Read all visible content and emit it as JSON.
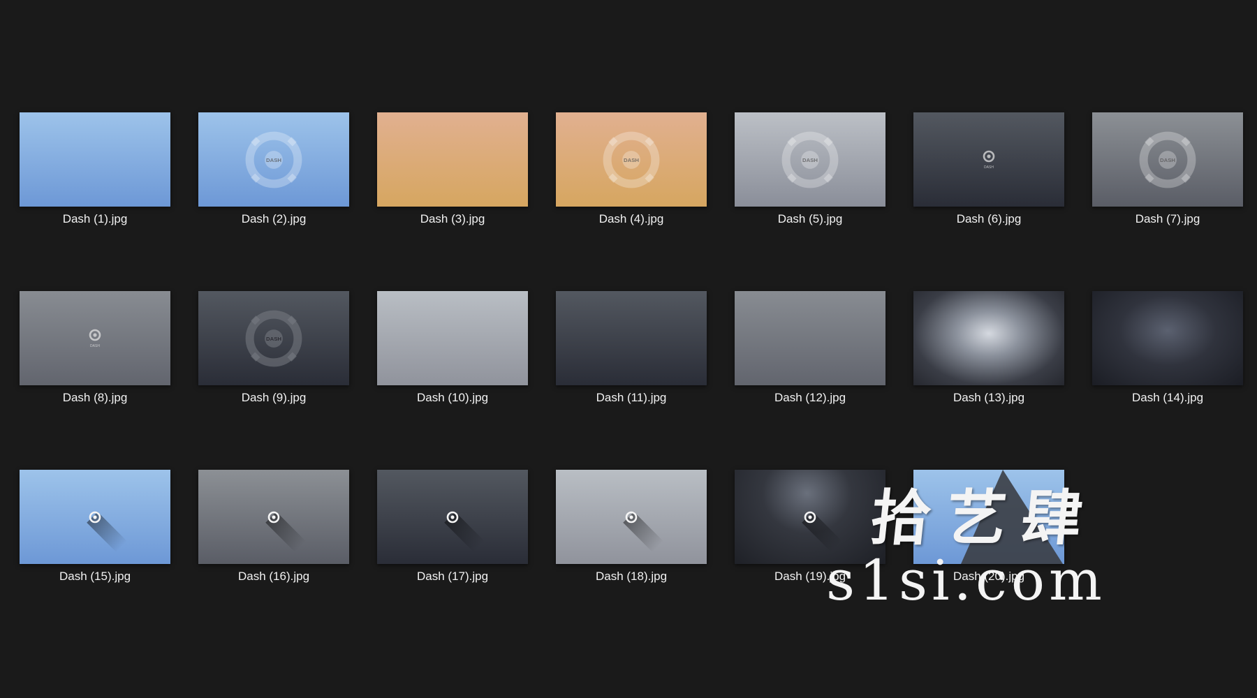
{
  "files": [
    {
      "name": "Dash (1).jpg",
      "bg": "bg-blue",
      "logo": "none"
    },
    {
      "name": "Dash (2).jpg",
      "bg": "bg-blue",
      "logo": "ring"
    },
    {
      "name": "Dash (3).jpg",
      "bg": "bg-orange",
      "logo": "none"
    },
    {
      "name": "Dash (4).jpg",
      "bg": "bg-orange",
      "logo": "ring"
    },
    {
      "name": "Dash (5).jpg",
      "bg": "bg-silver",
      "logo": "ring"
    },
    {
      "name": "Dash (6).jpg",
      "bg": "bg-dark",
      "logo": "small-text"
    },
    {
      "name": "Dash (7).jpg",
      "bg": "bg-gray",
      "logo": "ring"
    },
    {
      "name": "Dash (8).jpg",
      "bg": "bg-mid",
      "logo": "small-text"
    },
    {
      "name": "Dash (9).jpg",
      "bg": "bg-dark",
      "logo": "ring-dark"
    },
    {
      "name": "Dash (10).jpg",
      "bg": "bg-light",
      "logo": "none"
    },
    {
      "name": "Dash (11).jpg",
      "bg": "bg-dark",
      "logo": "none"
    },
    {
      "name": "Dash (12).jpg",
      "bg": "bg-mid",
      "logo": "none"
    },
    {
      "name": "Dash (13).jpg",
      "bg": "bg-glow-bright",
      "logo": "none"
    },
    {
      "name": "Dash (14).jpg",
      "bg": "bg-glow-dim",
      "logo": "none"
    },
    {
      "name": "Dash (15).jpg",
      "bg": "bg-blue",
      "logo": "small-shadow"
    },
    {
      "name": "Dash (16).jpg",
      "bg": "bg-gray",
      "logo": "small-shadow"
    },
    {
      "name": "Dash (17).jpg",
      "bg": "bg-dark",
      "logo": "small-shadow"
    },
    {
      "name": "Dash (18).jpg",
      "bg": "bg-light",
      "logo": "small-shadow"
    },
    {
      "name": "Dash (19).jpg",
      "bg": "bg-glow-dark",
      "logo": "small-shadow"
    },
    {
      "name": "Dash (20).jpg",
      "bg": "bg-blue",
      "logo": "none"
    }
  ],
  "logo_text": "DASH",
  "watermark": {
    "chinese": "拾艺肆",
    "url": "s1si.com"
  },
  "colors": {
    "background": "#1a1a1a",
    "label": "#f2f2f2",
    "watermark": "#f4f4f4"
  }
}
